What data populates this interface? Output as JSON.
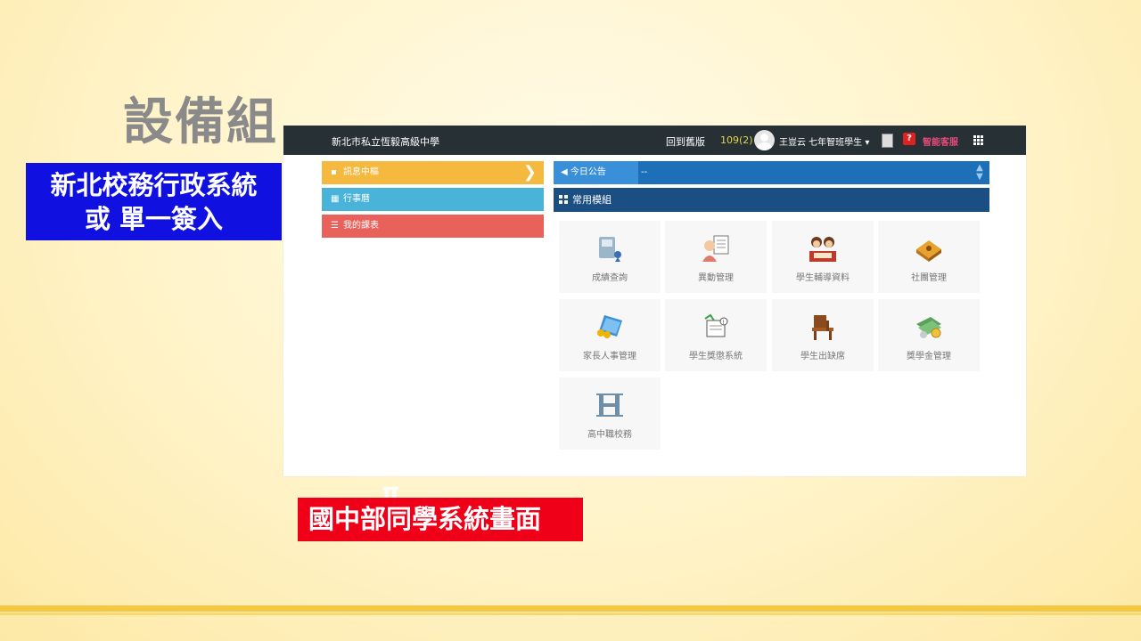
{
  "slide": {
    "title": "設備組",
    "blue_box_line1": "新北校務行政系統",
    "blue_box_line2": "或 單一簽入",
    "red_box": "國中部同學系統畫面",
    "ghost_mark": "π"
  },
  "topnav": {
    "school": "新北市私立恆毅高級中學",
    "back_link": "回到舊版",
    "term": "109(2)",
    "user": "王豈云 七年智班學生",
    "help_icon_text": "?",
    "service": "智能客服"
  },
  "left_menu": [
    {
      "label": "訊息中樞"
    },
    {
      "label": "行事曆"
    },
    {
      "label": "我的課表"
    }
  ],
  "notice": {
    "label": "今日公告",
    "text": "--"
  },
  "modules": {
    "header": "常用模組",
    "tiles": [
      {
        "label": "成績查詢",
        "icon": "grades-icon"
      },
      {
        "label": "異動管理",
        "icon": "change-icon"
      },
      {
        "label": "學生輔導資料",
        "icon": "counseling-icon"
      },
      {
        "label": "社團管理",
        "icon": "club-icon"
      },
      {
        "label": "家長人事管理",
        "icon": "parents-icon"
      },
      {
        "label": "學生獎懲系統",
        "icon": "reward-icon"
      },
      {
        "label": "學生出缺席",
        "icon": "attendance-icon"
      },
      {
        "label": "獎學金管理",
        "icon": "scholarship-icon"
      },
      {
        "label": "高中職校務",
        "icon": "highschool-icon"
      }
    ]
  }
}
